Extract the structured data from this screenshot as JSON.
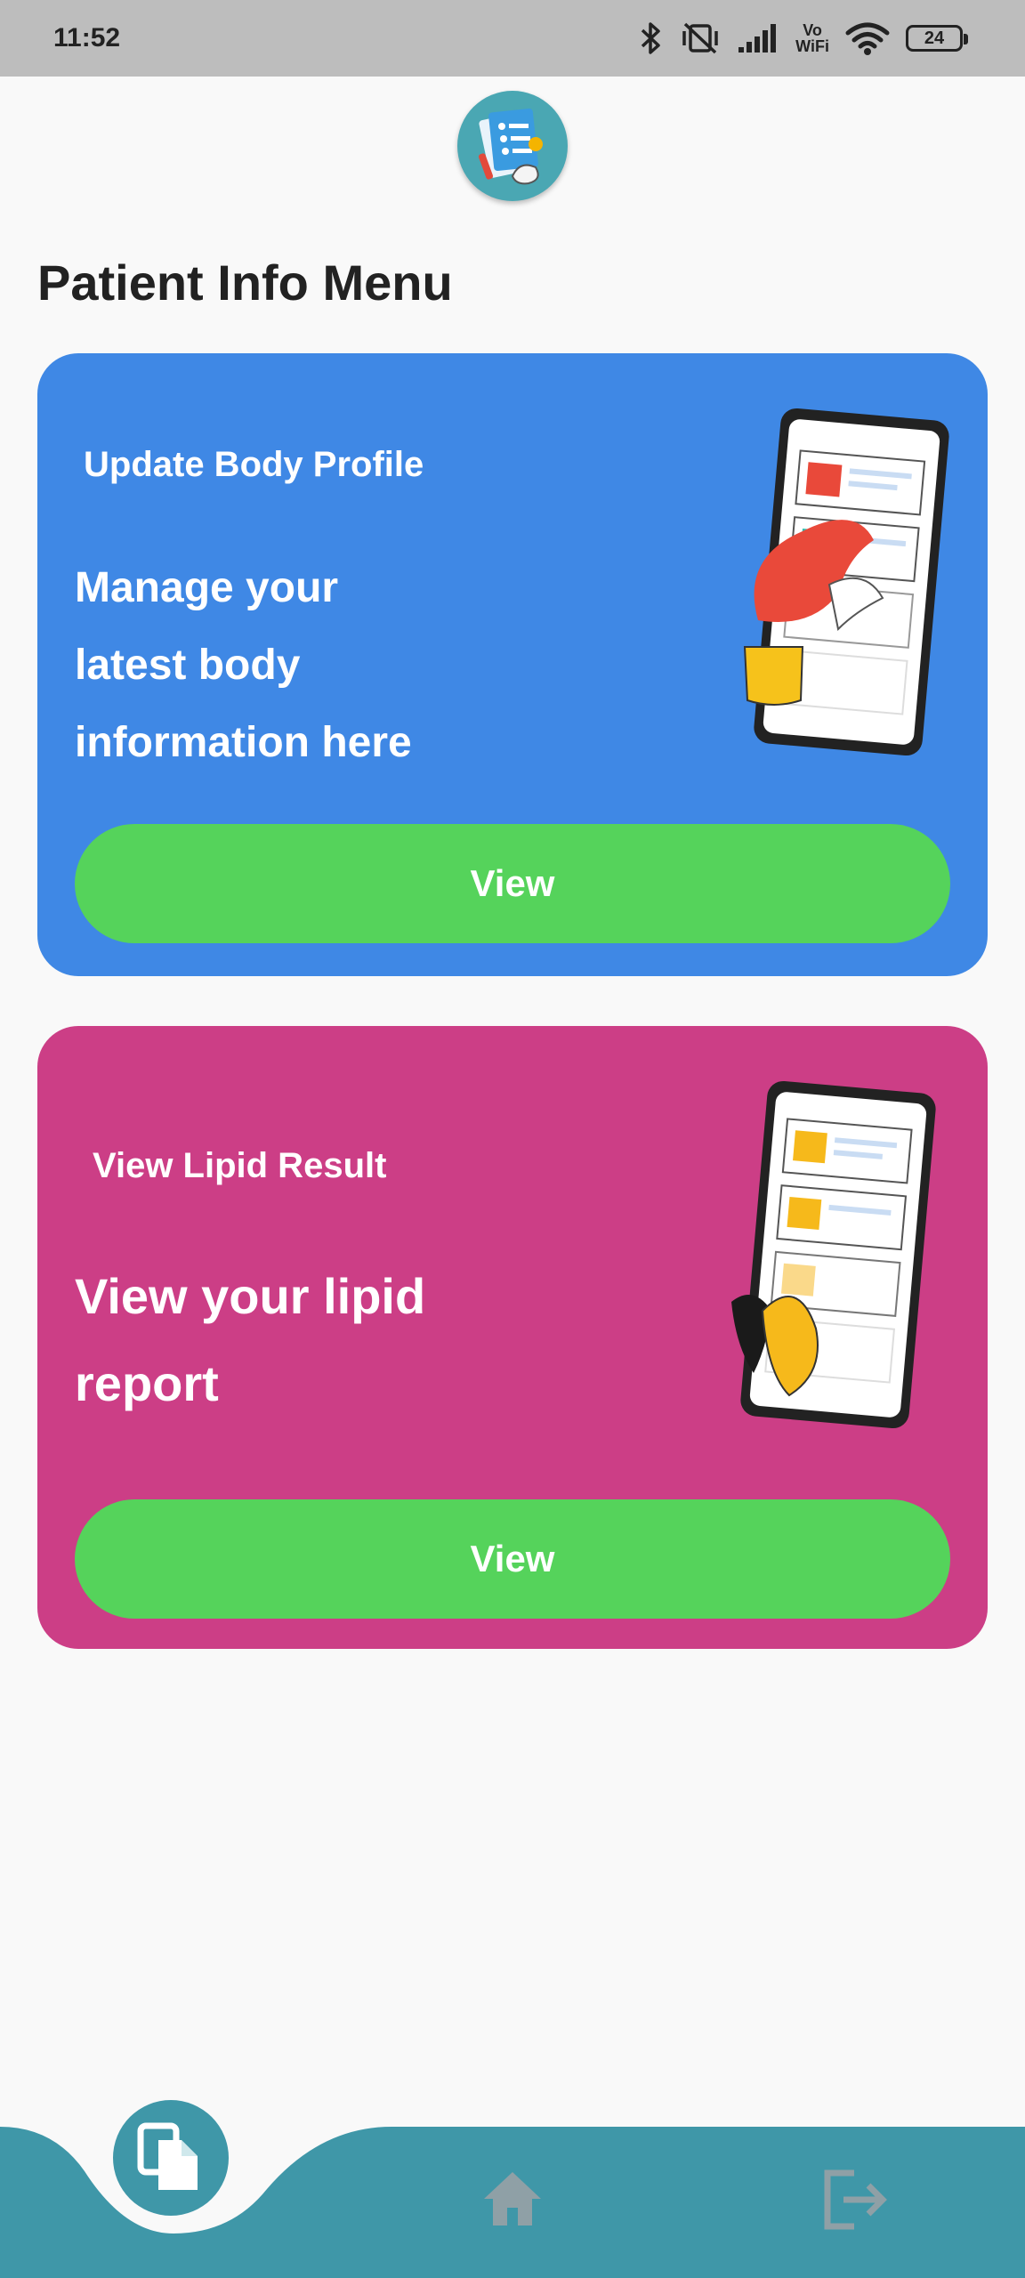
{
  "status_bar": {
    "time": "11:52",
    "wifi_label_top": "Vo",
    "wifi_label_bottom": "WiFi",
    "battery": "24"
  },
  "page": {
    "title": "Patient Info Menu"
  },
  "cards": [
    {
      "label": "Update Body Profile",
      "description": "Manage your\nlatest body\ninformation here",
      "button_label": "View",
      "color": "#3f88e5"
    },
    {
      "label": "View Lipid Result",
      "description": "View your lipid\nreport",
      "button_label": "View",
      "color": "#cc3e86"
    }
  ],
  "bottom_nav": {
    "items": [
      "documents-icon",
      "home-icon",
      "logout-icon"
    ],
    "active": "documents-icon",
    "color": "#3f97a8"
  },
  "colors": {
    "button": "#55d35b",
    "status_bar": "#bdbdbd",
    "background": "#f9f9f9"
  }
}
